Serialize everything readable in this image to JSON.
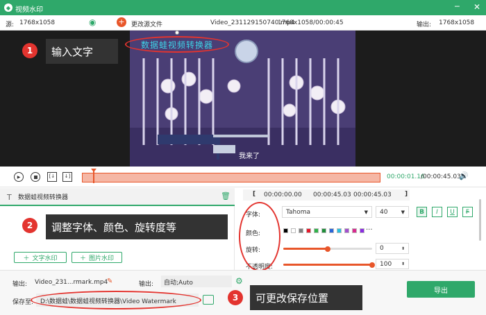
{
  "app": {
    "title": "视频水印"
  },
  "info": {
    "source_label": "源:",
    "source_res": "1768x1058",
    "change_source": "更改源文件",
    "file_name": "Video_231129150740.mp4",
    "file_meta": "1768x1058/00:00:45",
    "output_label": "输出:",
    "output_res": "1768x1058"
  },
  "annotations": {
    "a1": {
      "num": "1",
      "text": "输入文字"
    },
    "a2": {
      "num": "2",
      "text": "调整字体、颜色、旋转度等"
    },
    "a3": {
      "num": "3",
      "text": "可更改保存位置"
    }
  },
  "video": {
    "watermark_text": "数据蛙视频转换器",
    "subtitle": "我来了"
  },
  "playback": {
    "current": "00:00:01.16",
    "total": "/00:00:45.03",
    "progress": 0.038
  },
  "layers": {
    "watermark_item": "数据蛙视频转换器",
    "add_text": "文字水印",
    "add_image": "图片水印"
  },
  "time_range": {
    "start": "00:00:00.00",
    "end": "00:00:45.03",
    "duration": "00:00:45.03"
  },
  "props": {
    "font_label": "字体:",
    "font": "Tahoma",
    "size": "40",
    "color_label": "颜色:",
    "rotate_label": "旋转:",
    "rotate_value": "0",
    "rotate_level": 0.5,
    "opacity_label": "不透明度:",
    "opacity_value": "100",
    "opacity_level": 1.0,
    "style_bold": "B",
    "style_italic": "I",
    "style_underline": "U",
    "style_strike": "F",
    "colors": [
      "#000000",
      "#ffffff",
      "#7f7f7f",
      "#e6192b",
      "#2fb34a",
      "#1f8f3a",
      "#2a66d9",
      "#28c0e0",
      "#a34fd0",
      "#d9298f",
      "#8a2be2"
    ]
  },
  "bottom": {
    "output_label": "输出:",
    "output_file": "Video_231...rmark.mp4",
    "output_format_label": "输出:",
    "output_format": "自动;Auto",
    "save_label": "保存至:",
    "save_path": "D:\\数据蛙\\数据蛙视频转换器\\Video Watermark",
    "export": "导出"
  }
}
